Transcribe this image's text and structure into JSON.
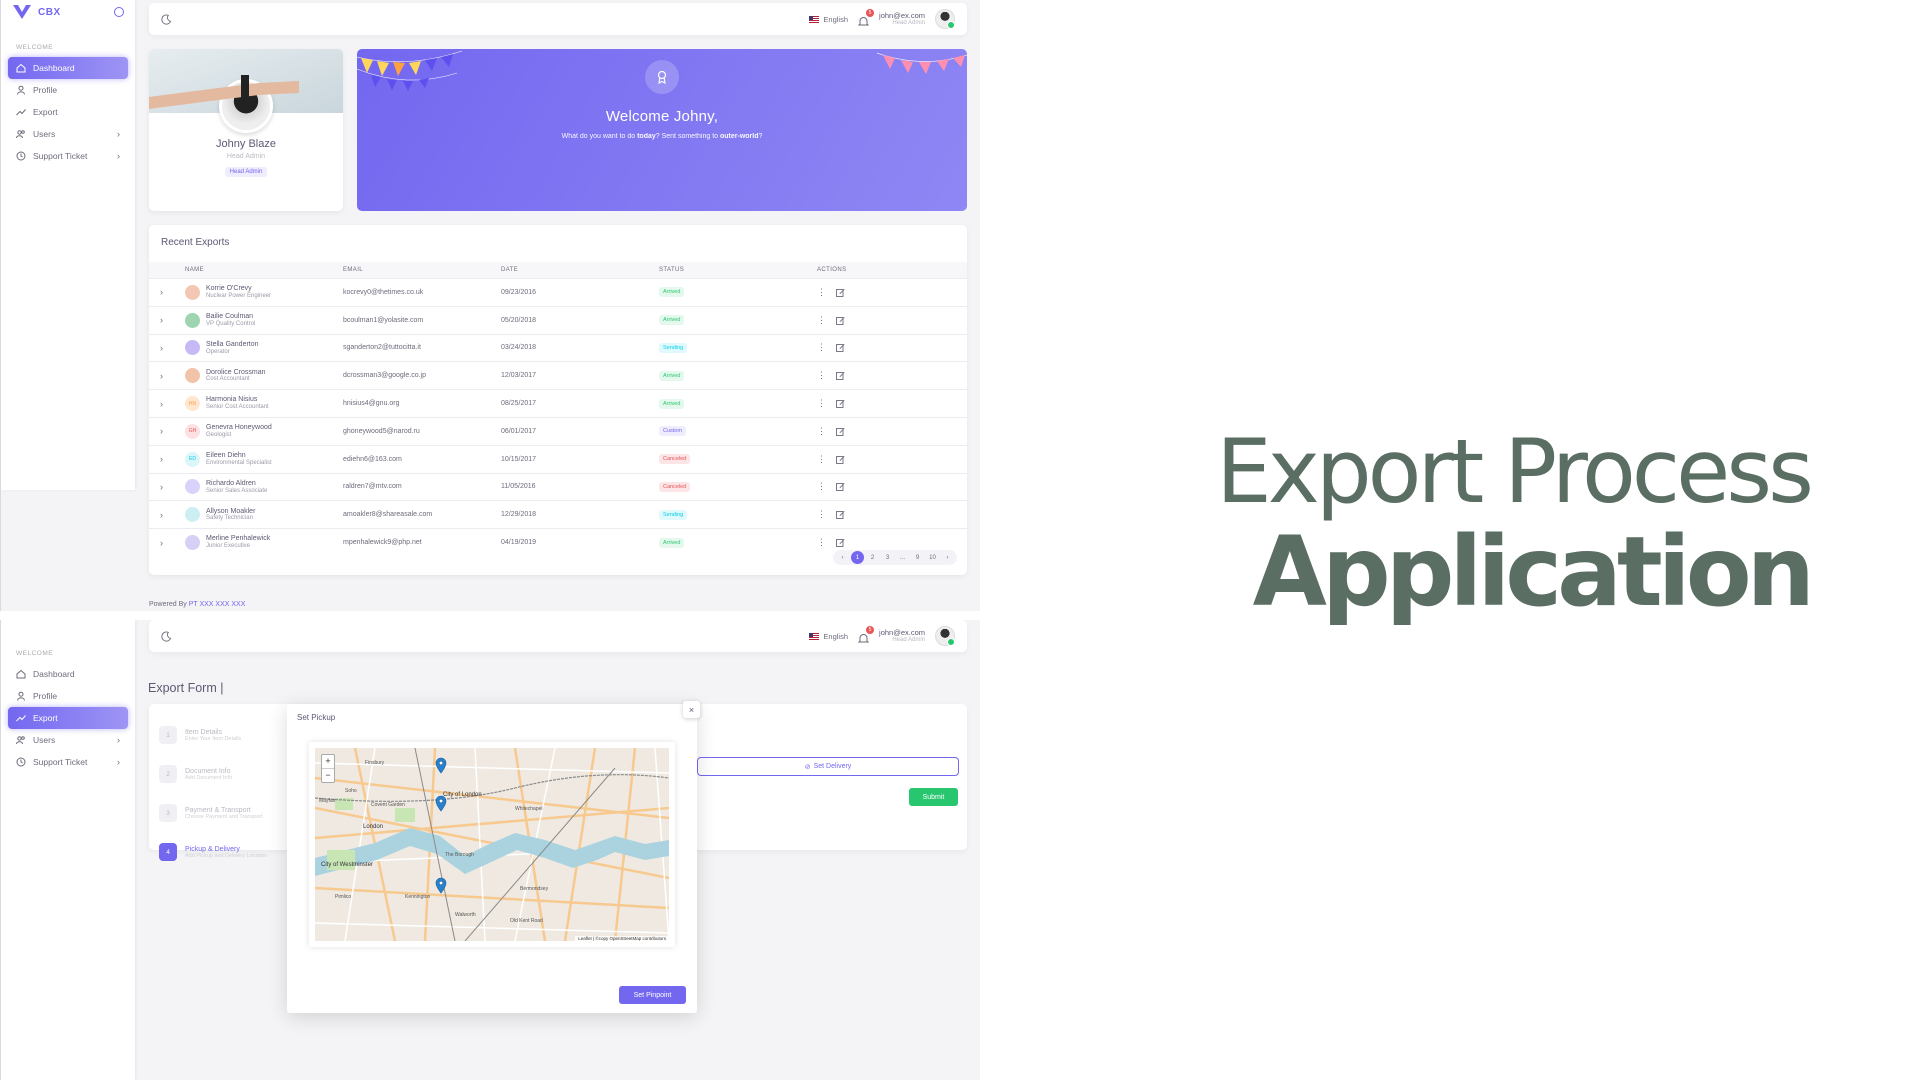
{
  "brand": {
    "name": "CBX"
  },
  "sidebar": {
    "section": "WELCOME",
    "items": [
      {
        "label": "Dashboard",
        "icon": "home-icon"
      },
      {
        "label": "Profile",
        "icon": "user-icon"
      },
      {
        "label": "Export",
        "icon": "trending-up-icon"
      },
      {
        "label": "Users",
        "icon": "users-icon"
      },
      {
        "label": "Support Ticket",
        "icon": "clock-icon"
      }
    ]
  },
  "topbar": {
    "language": "English",
    "notification_count": "5",
    "user_email": "john@ex.com",
    "user_role": "Head Admin"
  },
  "profile": {
    "name": "Johny Blaze",
    "role": "Head Admin",
    "badge": "Head Admin"
  },
  "welcome": {
    "title": "Welcome Johny,",
    "sub_a": "What do you want to do ",
    "sub_b": "today",
    "sub_c": "? Sent something to ",
    "sub_d": "outer-world",
    "sub_e": "?"
  },
  "exports": {
    "title": "Recent Exports",
    "columns": [
      "NAME",
      "EMAIL",
      "DATE",
      "STATUS",
      "ACTIONS"
    ],
    "rows": [
      {
        "name": "Korrie O'Crevy",
        "role": "Nuclear Power Engineer",
        "email": "kocrevy0@thetimes.co.uk",
        "date": "09/23/2016",
        "status": "Arrived",
        "initials": ""
      },
      {
        "name": "Bailie Coulman",
        "role": "VP Quality Control",
        "email": "bcoulman1@yolasite.com",
        "date": "05/20/2018",
        "status": "Arrived",
        "initials": ""
      },
      {
        "name": "Stella Ganderton",
        "role": "Operator",
        "email": "sganderton2@tuttocitta.it",
        "date": "03/24/2018",
        "status": "Sending",
        "initials": ""
      },
      {
        "name": "Dorolice Crossman",
        "role": "Cost Accountant",
        "email": "dcrossman3@google.co.jp",
        "date": "12/03/2017",
        "status": "Arrived",
        "initials": ""
      },
      {
        "name": "Harmonia Nisius",
        "role": "Senior Cost Accountant",
        "email": "hnisius4@gnu.org",
        "date": "08/25/2017",
        "status": "Arrived",
        "initials": "HN"
      },
      {
        "name": "Genevra Honeywood",
        "role": "Geologist",
        "email": "ghoneywood5@narod.ru",
        "date": "06/01/2017",
        "status": "Custom",
        "initials": "GH"
      },
      {
        "name": "Eileen Diehn",
        "role": "Environmental Specialist",
        "email": "ediehn6@163.com",
        "date": "10/15/2017",
        "status": "Canceled",
        "initials": "ED"
      },
      {
        "name": "Richardo Aldren",
        "role": "Senior Sales Associate",
        "email": "raldren7@mtv.com",
        "date": "11/05/2016",
        "status": "Canceled",
        "initials": ""
      },
      {
        "name": "Allyson Moakler",
        "role": "Safety Technician",
        "email": "amoakler8@shareasale.com",
        "date": "12/29/2018",
        "status": "Sending",
        "initials": ""
      },
      {
        "name": "Merline Penhalewick",
        "role": "Junior Executive",
        "email": "mpenhalewick9@php.net",
        "date": "04/19/2019",
        "status": "Arrived",
        "initials": ""
      }
    ],
    "pages": [
      "1",
      "2",
      "3",
      "...",
      "9",
      "10"
    ],
    "current_page": "1"
  },
  "footer": {
    "prefix": "Powered By ",
    "company": "PT XXX XXX XXX"
  },
  "export_form": {
    "title": "Export Form |",
    "steps": [
      {
        "num": "1",
        "title": "Item Details",
        "sub": "Enter Your Item Details"
      },
      {
        "num": "2",
        "title": "Document Info",
        "sub": "Add Document Info"
      },
      {
        "num": "3",
        "title": "Payment & Transport",
        "sub": "Choose Payment and Transport"
      },
      {
        "num": "4",
        "title": "Pickup & Delivery",
        "sub": "Add Pickup and Delivery Location"
      }
    ],
    "delivery_button": "Set Delivery",
    "submit_button": "Submit"
  },
  "modal": {
    "title": "Set Pickup",
    "close": "×",
    "zoom_in": "+",
    "zoom_out": "−",
    "attribution": "Leaflet | ©copy OpenStreetMap contributors",
    "pinpoint_button": "Set Pinpoint",
    "map_labels": [
      "Finsbury",
      "City of London",
      "London",
      "The Borough",
      "City of Westminster",
      "Whitechapel",
      "Bermondsey",
      "Walworth",
      "Old Kent Road",
      "Soho",
      "Mayfair",
      "Pimlico",
      "Kennington",
      "Covent Garden"
    ]
  },
  "hero": {
    "line1": "Export Process",
    "line2": "Application"
  },
  "colors": {
    "accent": "#7367f0",
    "success": "#28c76f",
    "danger": "#ea5455",
    "info": "#00cfe8",
    "hero_text": "#5a6e63"
  }
}
